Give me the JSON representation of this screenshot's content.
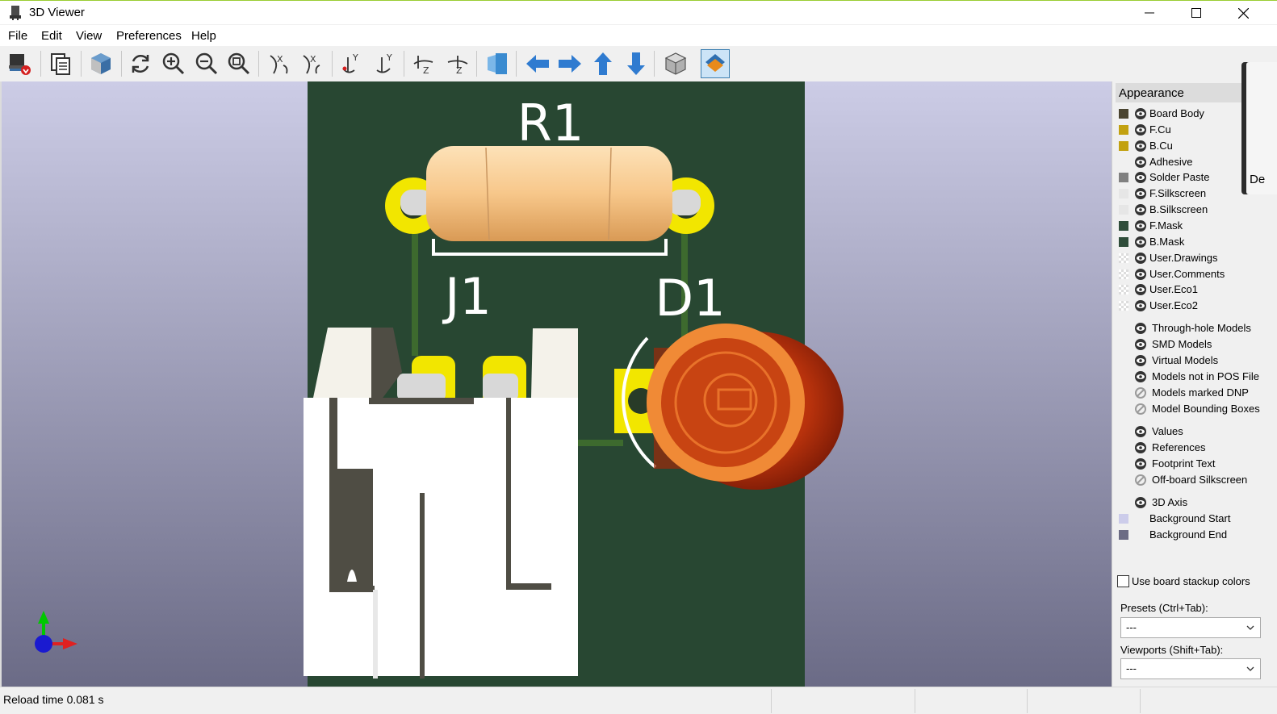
{
  "window": {
    "title": "3D Viewer"
  },
  "menu": [
    "File",
    "Edit",
    "View",
    "Preferences",
    "Help"
  ],
  "toolbar": {
    "tools": [
      "reload-board-icon",
      "copy-image-icon",
      "raytrace-icon",
      "rotate-refresh-icon",
      "zoom-in-icon",
      "zoom-out-icon",
      "zoom-fit-icon",
      "rotate-x-cw-icon",
      "rotate-x-ccw-icon",
      "rotate-y-cw-icon",
      "rotate-y-ccw-icon",
      "rotate-z-cw-icon",
      "rotate-z-ccw-icon",
      "flip-board-icon",
      "move-left-icon",
      "move-right-icon",
      "move-up-icon",
      "move-down-icon",
      "orthographic-icon",
      "layers-manager-icon"
    ]
  },
  "board": {
    "refs": {
      "r1": "R1",
      "j1": "J1",
      "d1": "D1"
    }
  },
  "panel": {
    "title": "Appearance",
    "layers": [
      {
        "label": "Board Body",
        "color": "#4a4430",
        "eye": "show"
      },
      {
        "label": "F.Cu",
        "color": "#c2a110",
        "eye": "show"
      },
      {
        "label": "B.Cu",
        "color": "#c2a110",
        "eye": "show"
      },
      {
        "label": "Adhesive",
        "color": "",
        "eye": "show"
      },
      {
        "label": "Solder Paste",
        "color": "#808080",
        "eye": "show"
      },
      {
        "label": "F.Silkscreen",
        "color": "#e6e6e6",
        "eye": "show"
      },
      {
        "label": "B.Silkscreen",
        "color": "#e6e6e6",
        "eye": "show"
      },
      {
        "label": "F.Mask",
        "color": "#2f4d3a",
        "eye": "show"
      },
      {
        "label": "B.Mask",
        "color": "#2f4d3a",
        "eye": "show"
      },
      {
        "label": "User.Drawings",
        "color": "checker",
        "eye": "show"
      },
      {
        "label": "User.Comments",
        "color": "checker",
        "eye": "show"
      },
      {
        "label": "User.Eco1",
        "color": "checker",
        "eye": "show"
      },
      {
        "label": "User.Eco2",
        "color": "checker",
        "eye": "show"
      }
    ],
    "models": [
      {
        "label": "Through-hole Models",
        "eye": "show"
      },
      {
        "label": "SMD Models",
        "eye": "show"
      },
      {
        "label": "Virtual Models",
        "eye": "show"
      },
      {
        "label": "Models not in POS File",
        "eye": "show"
      },
      {
        "label": "Models marked DNP",
        "eye": "hide"
      },
      {
        "label": "Model Bounding Boxes",
        "eye": "hide"
      }
    ],
    "text_items": [
      {
        "label": "Values",
        "eye": "show"
      },
      {
        "label": "References",
        "eye": "show"
      },
      {
        "label": "Footprint Text",
        "eye": "show"
      },
      {
        "label": "Off-board Silkscreen",
        "eye": "hide"
      }
    ],
    "other": [
      {
        "label": "3D Axis",
        "eye": "show",
        "color": ""
      },
      {
        "label": "Background Start",
        "eye": "",
        "color": "#ccccea"
      },
      {
        "label": "Background End",
        "eye": "",
        "color": "#6c6c84"
      }
    ],
    "use_stackup": "Use board stackup colors",
    "presets_label": "Presets (Ctrl+Tab):",
    "presets_value": "---",
    "viewports_label": "Viewports (Shift+Tab):",
    "viewports_value": "---",
    "tooltip_peek": "De"
  },
  "status": {
    "text": "Reload time 0.081 s"
  }
}
